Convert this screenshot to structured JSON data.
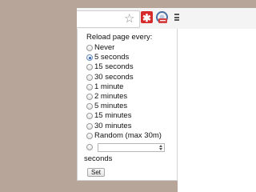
{
  "toolbar": {
    "icons": [
      "star-icon",
      "red-extension-icon",
      "reload-extension-icon",
      "menu-icon"
    ]
  },
  "popup": {
    "title": "Reload page every:",
    "options": [
      {
        "label": "Never",
        "checked": false
      },
      {
        "label": "5 seconds",
        "checked": true
      },
      {
        "label": "15 seconds",
        "checked": false
      },
      {
        "label": "30 seconds",
        "checked": false
      },
      {
        "label": "1 minute",
        "checked": false
      },
      {
        "label": "2 minutes",
        "checked": false
      },
      {
        "label": "5 minutes",
        "checked": false
      },
      {
        "label": "15 minutes",
        "checked": false
      },
      {
        "label": "30 minutes",
        "checked": false
      },
      {
        "label": "Random (max 30m)",
        "checked": false
      }
    ],
    "custom_value": "",
    "seconds_label": "seconds",
    "set_label": "Set"
  },
  "colors": {
    "background": "#b7a599",
    "accent_strip": "#43a6d6",
    "red_icon": "#d62a2a"
  }
}
